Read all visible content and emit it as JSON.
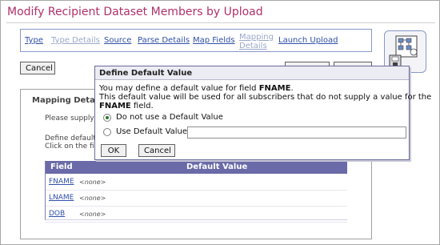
{
  "page": {
    "title": "Modify Recipient Dataset Members by Upload"
  },
  "tabs": [
    {
      "label": "Type",
      "state": "link"
    },
    {
      "label": "Type Details",
      "state": "disabled"
    },
    {
      "label": "Source",
      "state": "link"
    },
    {
      "label": "Parse Details",
      "state": "link"
    },
    {
      "label": "Map Fields",
      "state": "link"
    },
    {
      "label_line1": "Mapping",
      "label_line2": "Details",
      "state": "disabled"
    },
    {
      "label": "Launch Upload",
      "state": "link"
    }
  ],
  "toolbar": {
    "cancel_label": "Cancel"
  },
  "panel": {
    "heading": "Mapping Detail",
    "please_text": "Please supply",
    "define_text": "Define default",
    "click_text": "Click on the fi",
    "table": {
      "headers": [
        "Field",
        "Default Value"
      ],
      "rows": [
        {
          "field": "FNAME",
          "value": "<none>"
        },
        {
          "field": "LNAME",
          "value": "<none>"
        },
        {
          "field": "DOB",
          "value": "<none>"
        }
      ]
    }
  },
  "dialog": {
    "title": "Define Default Value",
    "line1": "You may define a default value for field FNAME.",
    "line2": "This default value will be used for all subscribers that do not supply a value for the",
    "line3": "FNAME field.",
    "option_none": "Do not use a Default Value",
    "option_default": "Use Default Value:",
    "selected_option": "none",
    "default_value": "",
    "ok_label": "OK",
    "cancel_label": "Cancel"
  },
  "colors": {
    "title": "#b0306a",
    "link": "#3050a8",
    "table_header": "#6a6aa8"
  },
  "icons": {
    "wizard": "upload-wizard-icon"
  }
}
